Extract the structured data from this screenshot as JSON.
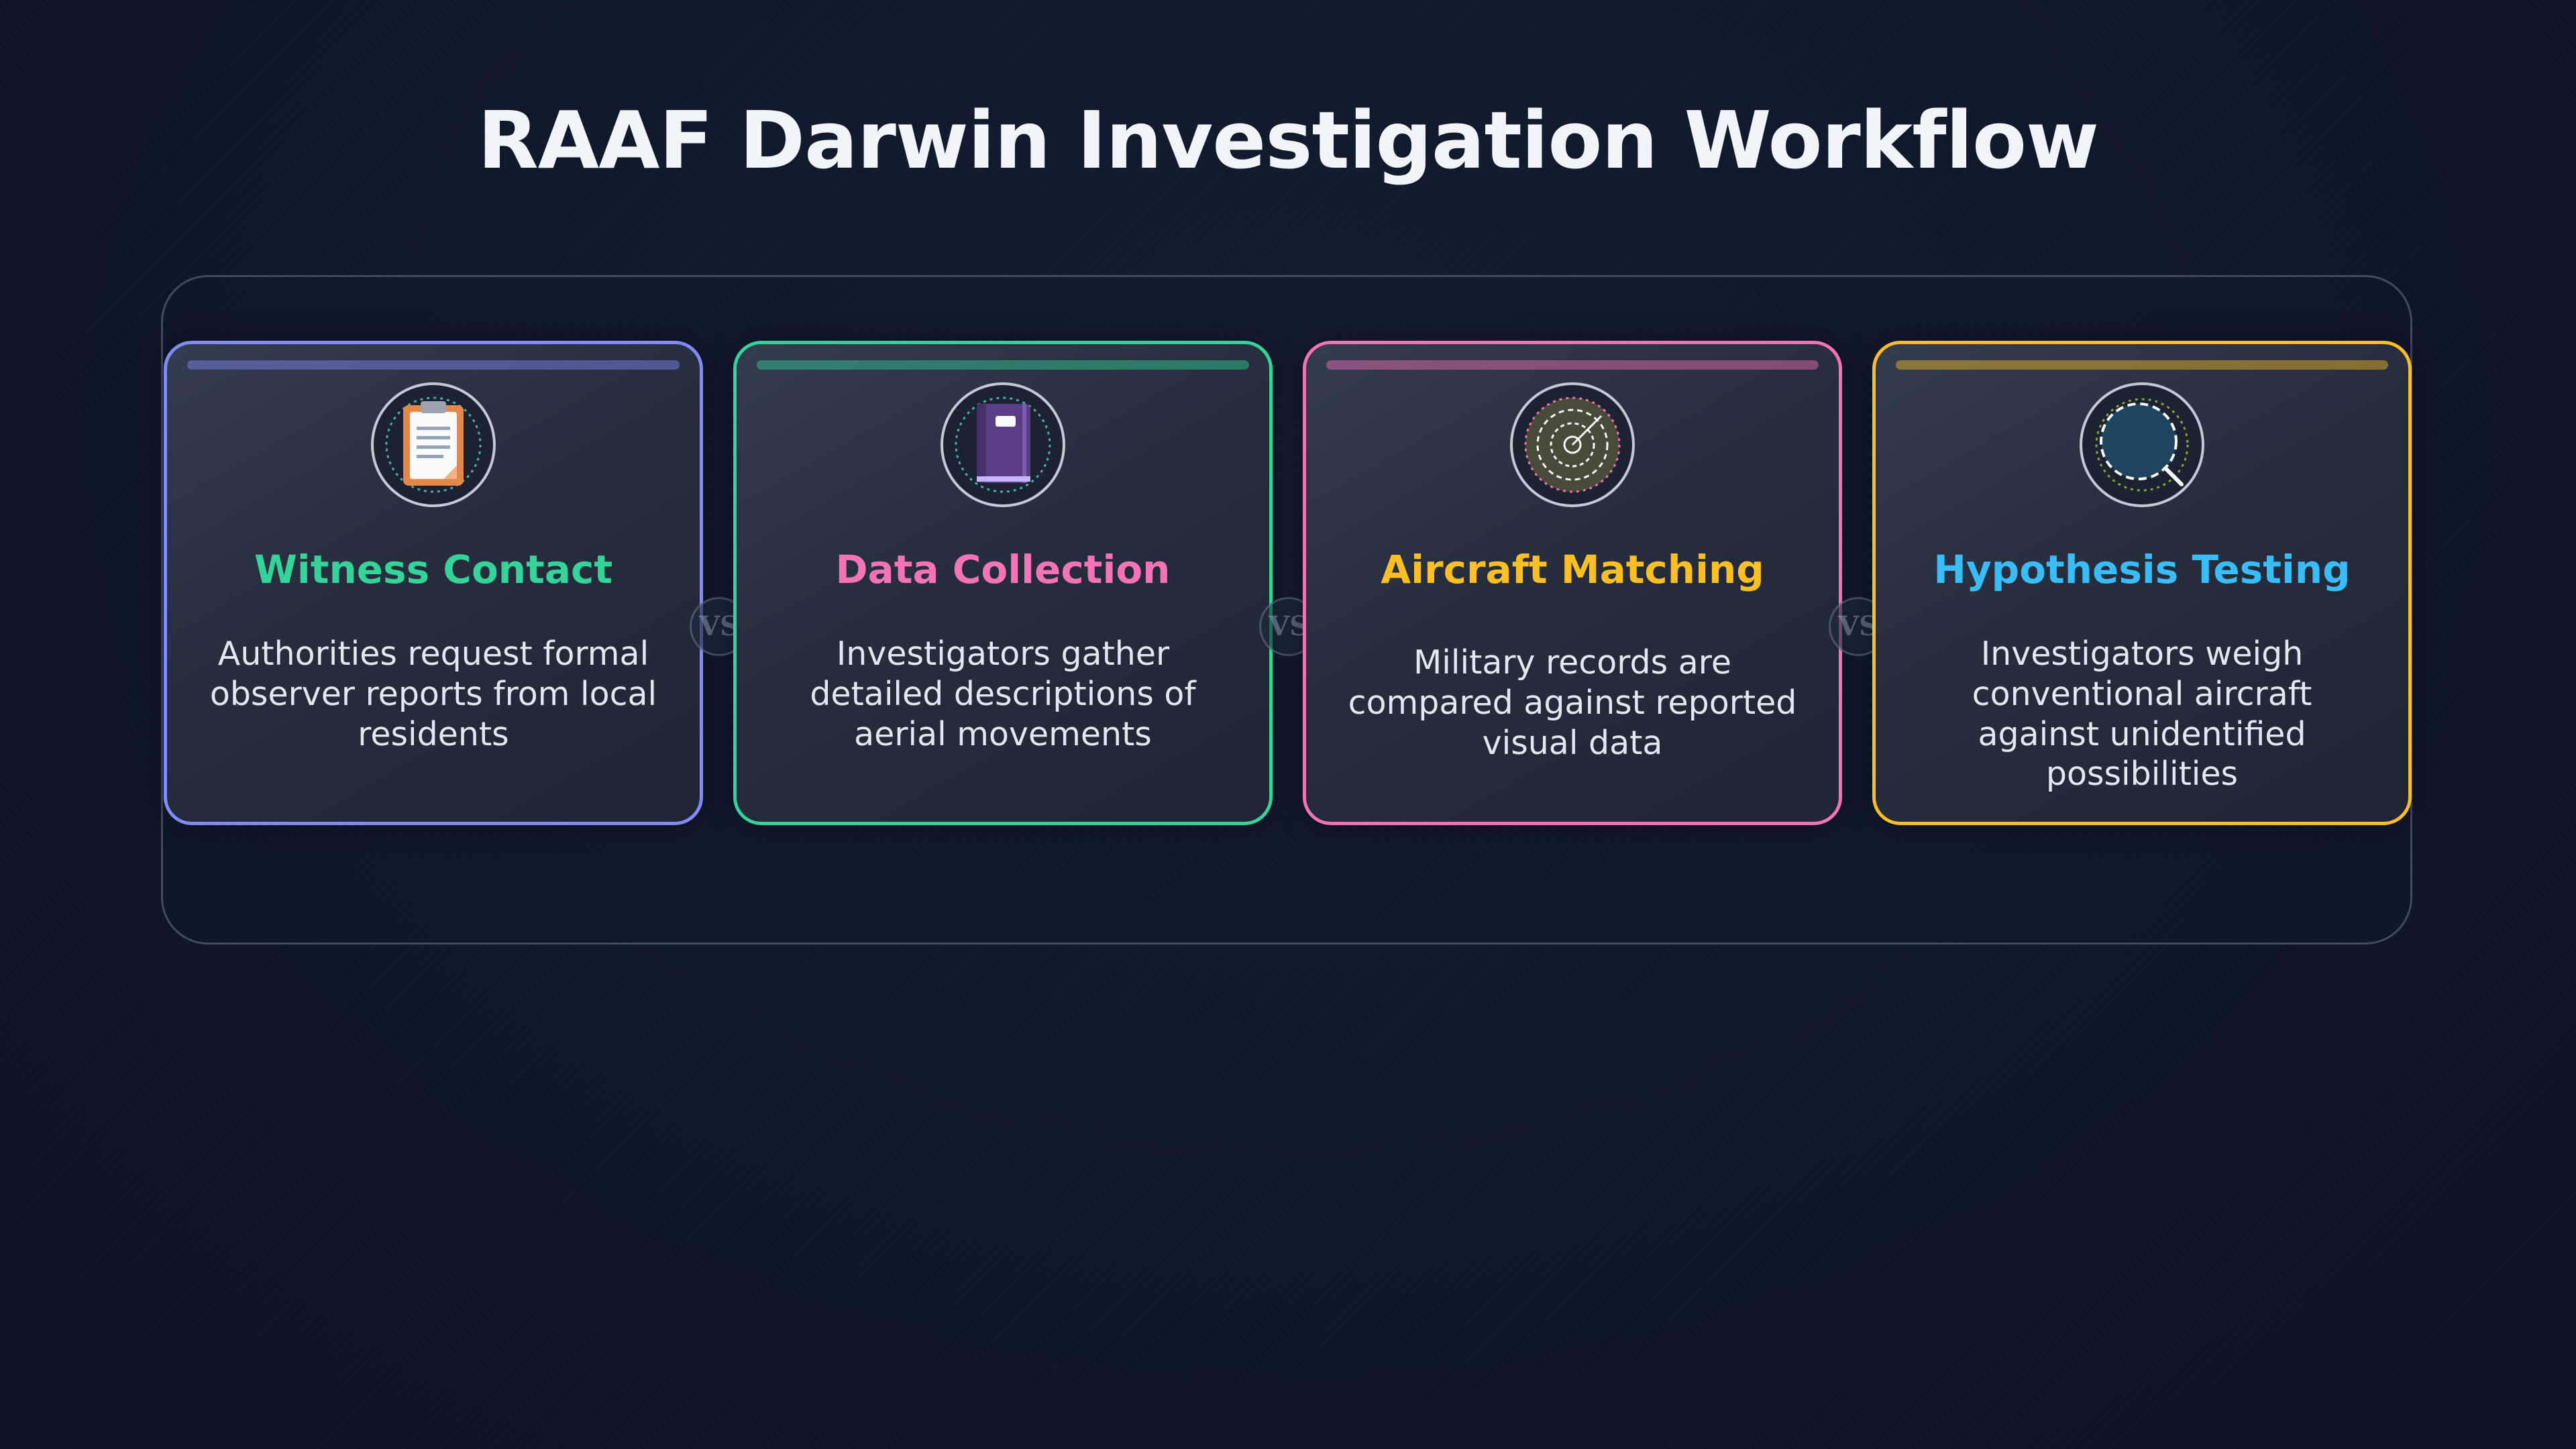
{
  "title": "RAAF Darwin Investigation Workflow",
  "connector_label": "VS",
  "steps": [
    {
      "title": "Witness Contact",
      "description": "Authorities request formal observer reports from local residents",
      "icon": "clipboard-icon",
      "accent": "#818cf8",
      "title_color": "#34d399"
    },
    {
      "title": "Data Collection",
      "description": "Investigators gather detailed descriptions of aerial movements",
      "icon": "notebook-icon",
      "accent": "#34d399",
      "title_color": "#f472b6"
    },
    {
      "title": "Aircraft Matching",
      "description": "Military records are compared against reported visual data",
      "icon": "radar-icon",
      "accent": "#f472b6",
      "title_color": "#fbbf24"
    },
    {
      "title": "Hypothesis Testing",
      "description": "Investigators weigh conventional aircraft against unidentified possibilities",
      "icon": "magnifier-icon",
      "accent": "#fbbf24",
      "title_color": "#38bdf8"
    }
  ]
}
